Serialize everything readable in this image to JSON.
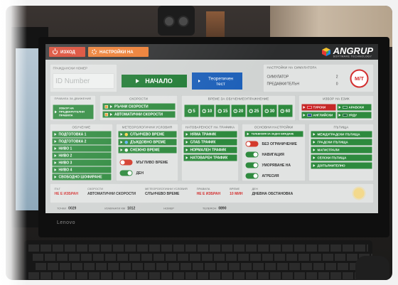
{
  "window": {
    "exit_label": "ИЗХОД",
    "settings_label": "НАСТРОЙКИ НА",
    "logo_text": "ANGRUP",
    "logo_subtext": "SOFTWARE TECHNOLOGY"
  },
  "identity": {
    "label": "ГРАЖДАНСКИ НОМЕР",
    "placeholder": "ID Number"
  },
  "start_label": "НАЧАЛО",
  "theory_label": "Теоретичен тест",
  "simulator": {
    "title": "НАСТРОЙКИ НА СИМУЛАТОРА",
    "rows": [
      {
        "label": "СИМУЛАТОР",
        "value": "2"
      },
      {
        "label": "ПРЕДАВКИ/ТЕЛЪН",
        "value": "0"
      }
    ],
    "badge": "М/Т"
  },
  "rules": {
    "title": "ПРАВИЛА ЗА ДВИЖЕНИЕ",
    "button_label": "ИЗБОР НА ПРЕДВАРИТЕЛНИ ПРАВИЛА"
  },
  "speeds": {
    "title": "СКОРОСТИ",
    "items": [
      "РЪЧНИ СКОРОСТИ",
      "АВТОМАТИЧНИ СКОРОСТИ"
    ]
  },
  "time": {
    "title": "ВРЕМЕ ЗА ОБУЧЕНИЕ/УПРАЖНЕНИЕ",
    "items": [
      "5",
      "10",
      "15",
      "20",
      "25",
      "30",
      "60"
    ]
  },
  "language": {
    "title": "ИЗБОР НА ЕЗИК",
    "items": [
      {
        "label": "ТУРСКИ",
        "active": true,
        "icon": "turkey-flag-icon"
      },
      {
        "label": "АРАБСКИ",
        "active": false,
        "icon": "arabic-flag-icon"
      },
      {
        "label": "АНГЛИЙСКИ",
        "active": false,
        "icon": "uk-flag-icon"
      },
      {
        "label": "УРДУ",
        "active": false,
        "icon": "pakistan-flag-icon"
      }
    ]
  },
  "training": {
    "title": "ОБУЧЕНИЕ",
    "items": [
      "ПОДГОТОВКА 1",
      "ПОДГОТОВКА 2",
      "НИВО 1",
      "НИВО 2",
      "НИВО 3",
      "НИВО 4",
      "СВОБОДНО ШОФИРАНЕ"
    ]
  },
  "weather": {
    "title": "МЕТЕОРОЛОГИЧНИ УСЛОВИЯ",
    "items": [
      {
        "label": "СЛЪНЧЕВО ВРЕМЕ",
        "icon": "sun-icon"
      },
      {
        "label": "ДЪЖДОВНО ВРЕМЕ",
        "icon": "rain-icon"
      },
      {
        "label": "СНЕЖНО ВРЕМЕ",
        "icon": "snow-icon"
      }
    ],
    "toggles": [
      {
        "label": "МЪГЛИВО ВРЕМЕ",
        "on": false
      },
      {
        "label": "ДЕН",
        "on": true
      }
    ]
  },
  "traffic": {
    "title": "НАТОВАРЕНОСТ НА ТРАФИКА",
    "items": [
      "НЯМА ТРАФИК",
      "СЛАБ ТРАФИК",
      "НОРМАЛЕН ТРАФИК",
      "НАТОВАРЕН ТРАФИК"
    ]
  },
  "basic": {
    "title": "ОСНОВНИ НАСТРОЙКИ",
    "top_button": "ТЕЛЕВИЗИЯ ЗА ЗАДНО ВИЖДАНЕ",
    "toggles": [
      {
        "label": "БЕЗ ОГРАНИЧЕНИЕ",
        "on": false
      },
      {
        "label": "НАВИГАЦИЯ",
        "on": true
      },
      {
        "label": "УМОРЯВАНЕ НА",
        "on": true
      },
      {
        "label": "АГРЕСИЯ",
        "on": true
      }
    ]
  },
  "roads": {
    "title": "ПЪТИЩА",
    "items": [
      "МЕЖДУГРАДСКИ ПЪТИЩА",
      "ГРАДСКИ ПЪТИЩА",
      "МАГИСТРАЛИ",
      "СЕЛСКИ ПЪТИЩА",
      "ДОПЪЛНИТЕЛНО"
    ]
  },
  "status": {
    "groups": [
      {
        "label": "ПЪТ",
        "value": "НЕ Е ИЗБРАН",
        "red": true
      },
      {
        "label": "СКОРОСТИ",
        "value": "АВТОМАТИЧНИ СКОРОСТИ",
        "red": false
      },
      {
        "label": "МЕТЕОРОЛОГИЧНИ УСЛОВИЯ",
        "value": "СЛЪНЧЕВО ВРЕМЕ",
        "red": false
      },
      {
        "label": "ПРАВИЛА",
        "value": "НЕ Е ИЗБРАН",
        "red": true
      },
      {
        "label": "ВРЕМЕ",
        "value": "10 МИН",
        "red": true
      },
      {
        "label": "ДЕН",
        "value": "ДНЕВНА ОБСТАНОВКА",
        "red": false
      }
    ],
    "icon": "sun-icon"
  },
  "footer": {
    "items": [
      {
        "label": "ТОЧКИ",
        "value": "0029"
      },
      {
        "label": "ИЗМИНАТИ КМ",
        "value": "1012"
      },
      {
        "label": "НОМЕР",
        "value": ""
      },
      {
        "label": "ТЕЛЕФОН",
        "value": "0890"
      }
    ]
  },
  "monitor_brand": "Lenovo",
  "colors": {
    "button_green": "#2e8a3e",
    "start_green": "#1f7a33",
    "theory_blue": "#1c5fb8",
    "exit_red": "#d8432c",
    "settings_orange": "#ec7b2f",
    "alert_red": "#d32f2f"
  }
}
